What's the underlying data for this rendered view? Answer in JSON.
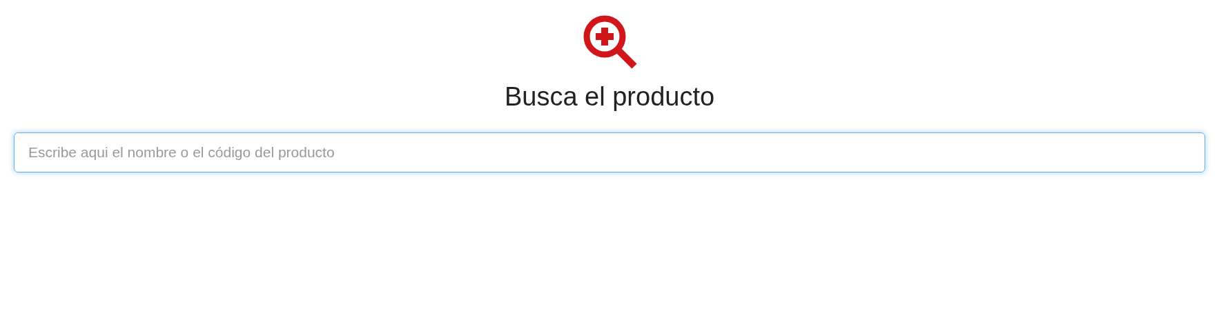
{
  "title": "Busca el producto",
  "search": {
    "placeholder": "Escribe aqui el nombre o el código del producto",
    "focused": true
  }
}
